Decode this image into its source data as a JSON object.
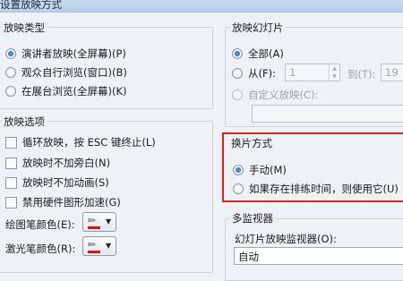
{
  "window": {
    "title": "设置放映方式"
  },
  "show_type": {
    "title": "放映类型",
    "options": [
      {
        "label": "演讲者放映(全屏幕)(P)",
        "selected": true
      },
      {
        "label": "观众自行浏览(窗口)(B)",
        "selected": false
      },
      {
        "label": "在展台浏览(全屏幕)(K)",
        "selected": false
      }
    ]
  },
  "show_options": {
    "title": "放映选项",
    "checks": [
      {
        "label": "循环放映，按 ESC 键终止(L)",
        "checked": false
      },
      {
        "label": "放映时不加旁白(N)",
        "checked": false
      },
      {
        "label": "放映时不加动画(S)",
        "checked": false
      },
      {
        "label": "禁用硬件图形加速(G)",
        "checked": false
      }
    ],
    "pen_color_label": "绘图笔颜色(E):",
    "laser_color_label": "激光笔颜色(R):",
    "pen_color": "#e01010",
    "laser_color": "#e01010"
  },
  "slides": {
    "title": "放映幻灯片",
    "all_label": "全部(A)",
    "from_label": "从(F):",
    "from_value": "1",
    "to_label": "到(T):",
    "to_value": "19",
    "custom_label": "自定义放映(C):"
  },
  "advance": {
    "title": "换片方式",
    "manual_label": "手动(M)",
    "timing_label": "如果存在排练时间，则使用它(U)",
    "highlight_color": "#e2231a"
  },
  "monitors": {
    "title": "多监视器",
    "monitor_label": "幻灯片放映监视器(O):",
    "monitor_value": "自动"
  }
}
